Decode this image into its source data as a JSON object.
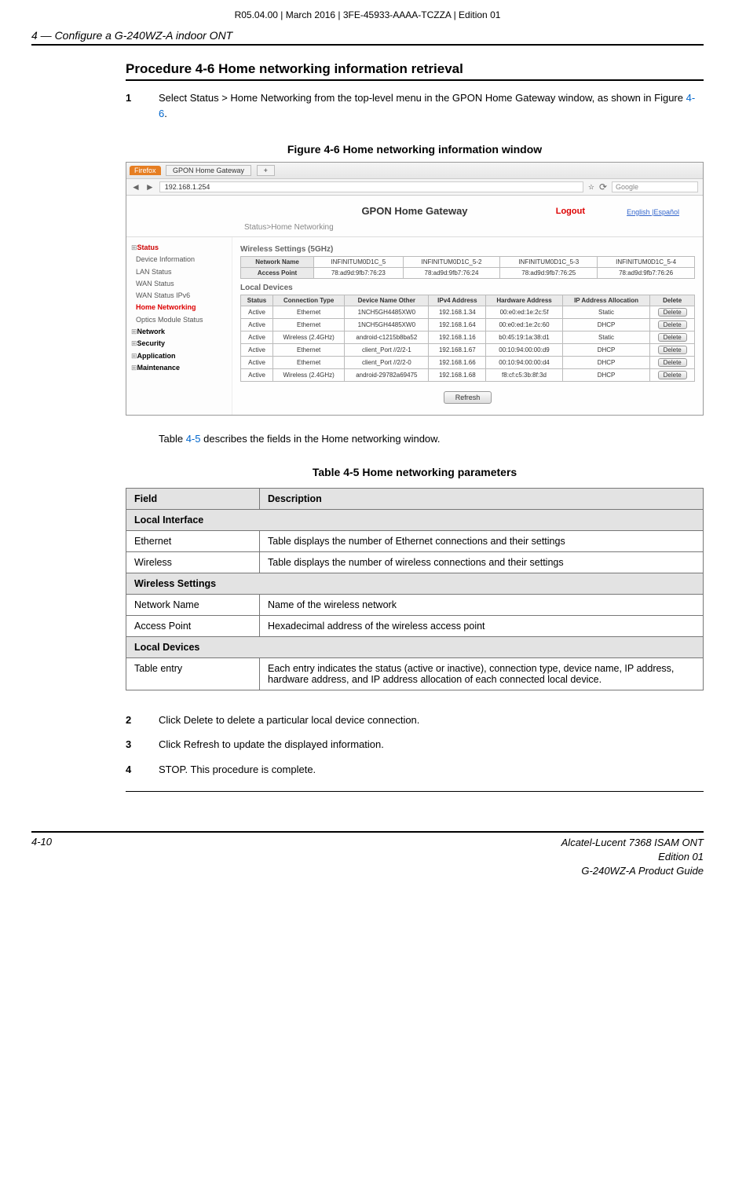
{
  "top_header": "R05.04.00 | March 2016 | 3FE-45933-AAAA-TCZZA | Edition 01",
  "chapter": "4 —  Configure a G-240WZ-A indoor ONT",
  "proc_title": "Procedure 4-6  Home networking information retrieval",
  "steps": {
    "s1": {
      "num": "1",
      "body_a": "Select Status > Home Networking from the top-level menu in the GPON Home Gateway window, as shown in Figure ",
      "ref": "4-6",
      "body_b": "."
    },
    "s2": {
      "num": "2",
      "body": "Click Delete to delete a particular local device connection."
    },
    "s3": {
      "num": "3",
      "body": "Click Refresh to update the displayed information."
    },
    "s4": {
      "num": "4",
      "body": "STOP. This procedure is complete."
    }
  },
  "fig_title": "Figure 4-6  Home networking information window",
  "browser": {
    "firefox": "Firefox",
    "tab": "GPON Home Gateway",
    "plus": "+",
    "url": "192.168.1.254",
    "search": "Google"
  },
  "gw": {
    "title": "GPON Home Gateway",
    "logout": "Logout",
    "langs": "English |Español",
    "breadcrumb": "Status>Home Networking",
    "sidebar": {
      "status": "Status",
      "items": [
        "Device Information",
        "LAN Status",
        "WAN Status",
        "WAN Status IPv6"
      ],
      "home_net": "Home Networking",
      "optics": "Optics Module Status",
      "network": "Network",
      "security": "Security",
      "application": "Application",
      "maintenance": "Maintenance"
    },
    "wireless_label": "Wireless Settings (5GHz)",
    "wtable": {
      "rows": [
        "Network Name",
        "Access Point"
      ],
      "cells": [
        [
          "INFINITUM0D1C_5",
          "INFINITUM0D1C_5-2",
          "INFINITUM0D1C_5-3",
          "INFINITUM0D1C_5-4"
        ],
        [
          "78:ad9d:9fb7:76:23",
          "78:ad9d:9fb7:76:24",
          "78:ad9d:9fb7:76:25",
          "78:ad9d:9fb7:76:26"
        ]
      ]
    },
    "local_label": "Local Devices",
    "dtable": {
      "headers": [
        "Status",
        "Connection Type",
        "Device Name Other",
        "IPv4 Address",
        "Hardware Address",
        "IP Address Allocation",
        "Delete"
      ],
      "rows": [
        [
          "Active",
          "Ethernet",
          "1NCH5GH4485XW0",
          "192.168.1.34",
          "00:e0:ed:1e:2c:5f",
          "Static"
        ],
        [
          "Active",
          "Ethernet",
          "1NCH5GH4485XW0",
          "192.168.1.64",
          "00:e0:ed:1e:2c:60",
          "DHCP"
        ],
        [
          "Active",
          "Wireless (2.4GHz)",
          "android-c1215b8ba52",
          "192.168.1.16",
          "b0:45:19:1a:38:d1",
          "Static"
        ],
        [
          "Active",
          "Ethernet",
          "client_Port //2/2-1",
          "192.168.1.67",
          "00:10:94:00:00:d9",
          "DHCP"
        ],
        [
          "Active",
          "Ethernet",
          "client_Port //2/2-0",
          "192.168.1.66",
          "00:10:94:00:00:d4",
          "DHCP"
        ],
        [
          "Active",
          "Wireless (2.4GHz)",
          "android-29782a69475",
          "192.168.1.68",
          "f8:cf:c5:3b:8f:3d",
          "DHCP"
        ]
      ],
      "delete": "Delete"
    },
    "refresh": "Refresh"
  },
  "after_fig_a": "Table ",
  "after_fig_ref": "4-5",
  "after_fig_b": " describes the fields in the Home networking window.",
  "tbl_title": "Table 4-5 Home networking parameters",
  "param": {
    "h1": "Field",
    "h2": "Description",
    "sec1": "Local Interface",
    "r1a": "Ethernet",
    "r1b": "Table displays the number of Ethernet connections and their settings",
    "r2a": "Wireless",
    "r2b": "Table displays the number of wireless connections and their settings",
    "sec2": "Wireless Settings",
    "r3a": "Network Name",
    "r3b": "Name of the wireless network",
    "r4a": "Access Point",
    "r4b": "Hexadecimal address of the wireless access point",
    "sec3": "Local Devices",
    "r5a": "Table entry",
    "r5b": "Each entry indicates the status (active or inactive), connection type, device name, IP address, hardware address, and IP address allocation of each connected local device."
  },
  "footer": {
    "page": "4-10",
    "r1": "Alcatel-Lucent 7368 ISAM ONT",
    "r2": "Edition 01",
    "r3": "G-240WZ-A Product Guide"
  }
}
